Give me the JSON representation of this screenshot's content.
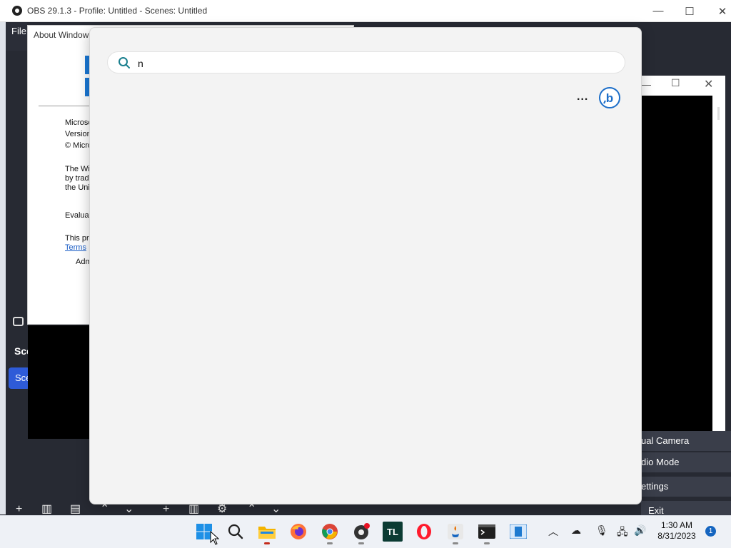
{
  "obs": {
    "title": "OBS 29.1.3 - Profile: Untitled - Scenes: Untitled",
    "menu_file": "File",
    "scenes_header": "Sce",
    "scene_item": "Sce",
    "controls": [
      "ual Camera",
      "dio Mode",
      "ettings",
      "Exit"
    ]
  },
  "about": {
    "title": "About Window",
    "lines": [
      "Microso",
      "Version",
      "© Micro",
      "The Wi",
      "by trad",
      "the Uni",
      "Evaluat",
      "This pro",
      "Terms",
      "Adm"
    ]
  },
  "search": {
    "query": "n",
    "more_label": "...",
    "bing_icon": "bing-chat-icon"
  },
  "taskbar": {
    "apps": [
      "start-icon",
      "search-icon",
      "file-explorer-icon",
      "firefox-icon",
      "chrome-icon",
      "obs-icon",
      "tl-icon",
      "opera-icon",
      "java-icon",
      "terminal-icon",
      "notepad-icon"
    ],
    "tl_label": "TL",
    "time": "1:30 AM",
    "date": "8/31/2023",
    "notification_count": "1"
  }
}
